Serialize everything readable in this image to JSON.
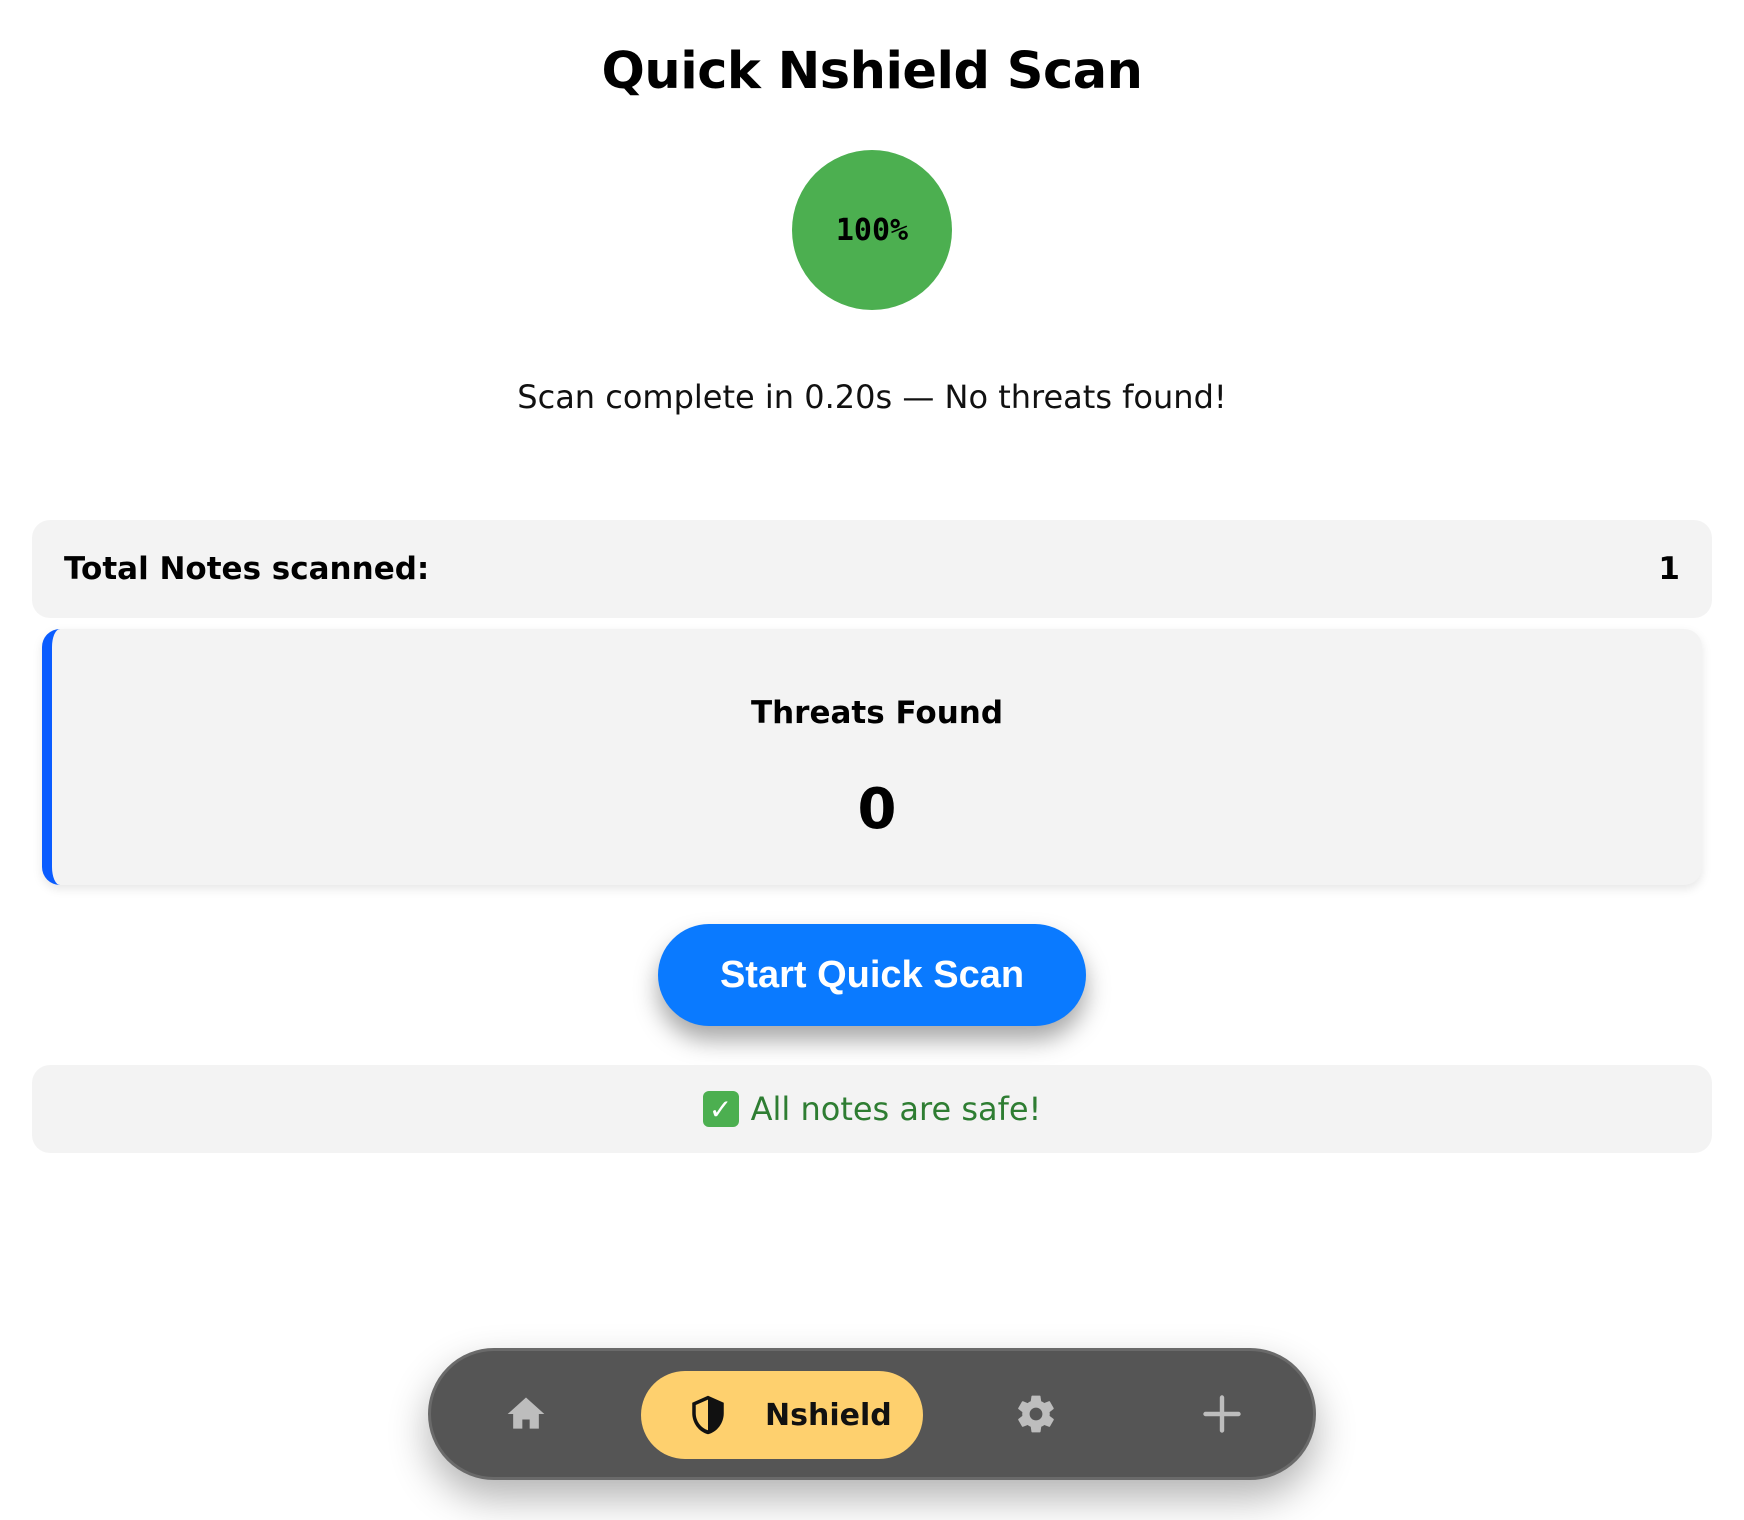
{
  "page": {
    "title": "Quick Nshield Scan"
  },
  "progress": {
    "value_percent": 100,
    "label": "100%",
    "color": "#4caf50"
  },
  "status": {
    "message": "Scan complete in 0.20s — No threats found!"
  },
  "summary": {
    "total_label": "Total Notes scanned:",
    "total_value": "1",
    "threats_label": "Threats Found",
    "threats_value": "0",
    "accent_color": "#0a5cff"
  },
  "actions": {
    "scan_button_label": "Start Quick Scan",
    "scan_button_color": "#0a7aff"
  },
  "result": {
    "icon": "check-mark-icon",
    "message": "All notes are safe!",
    "color": "#2e7d32"
  },
  "nav": {
    "items": [
      {
        "icon": "home-icon",
        "label": ""
      },
      {
        "icon": "shield-icon",
        "label": "Nshield",
        "active": true
      },
      {
        "icon": "gear-icon",
        "label": ""
      },
      {
        "icon": "plus-icon",
        "label": ""
      }
    ],
    "active_color": "#fed06e",
    "bar_color": "#555555"
  }
}
